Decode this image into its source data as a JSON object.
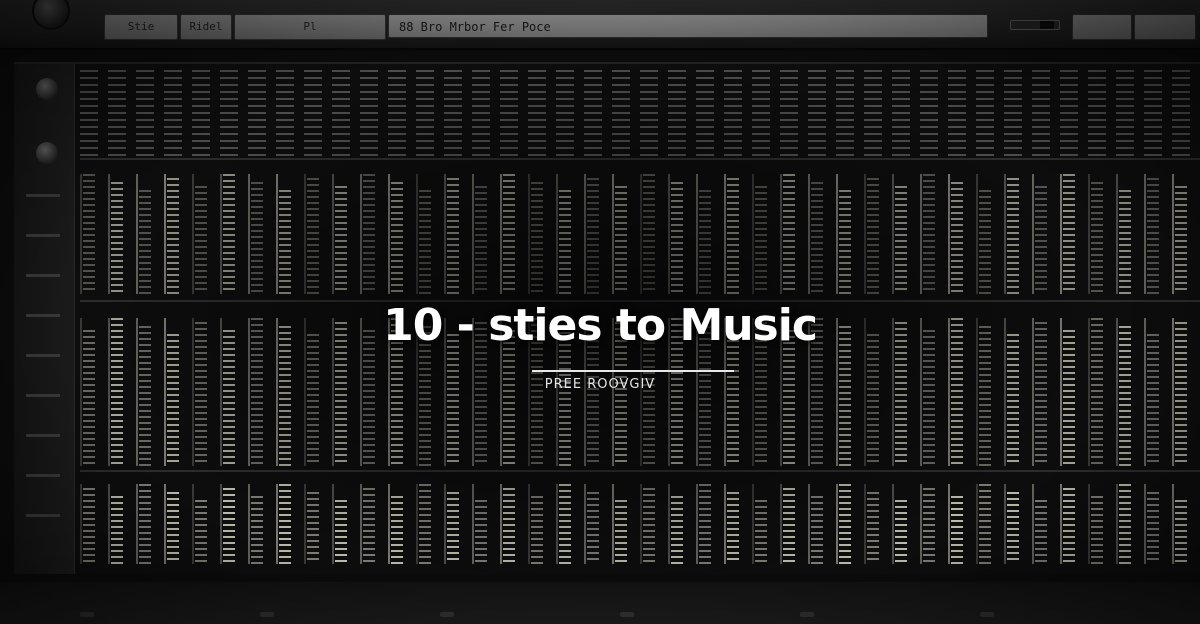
{
  "toolbar": {
    "buttons": [
      "Stie",
      "Ridel",
      "Pl"
    ],
    "display_text": "88 Bro Mrbor Fer Poce",
    "right_buttons": [
      "",
      "",
      ""
    ]
  },
  "hero": {
    "title": "10 - sties to Music",
    "subtitle": "PREE ROOVGIV"
  },
  "colors": {
    "background": "#0b0b0b",
    "text": "#ffffff",
    "meter": "#d8d8c8"
  },
  "icons": {
    "top_knob": "knob-icon",
    "arrow": "chevron-icon"
  }
}
